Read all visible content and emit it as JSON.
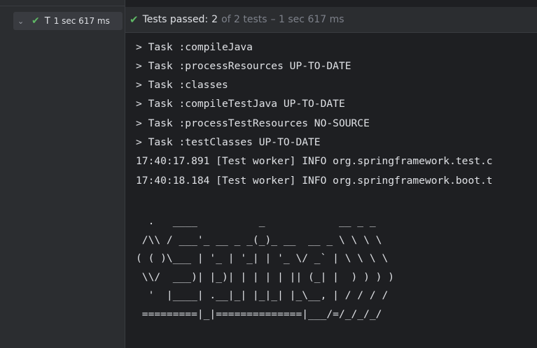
{
  "tree": {
    "chevron": "⌄",
    "check_icon": "check-icon",
    "item_name": "T",
    "item_time": "1 sec 617 ms"
  },
  "status": {
    "check_icon": "check-icon",
    "passed_label": "Tests passed:",
    "passed_count": "2",
    "of_total": "of 2 tests",
    "duration": "– 1 sec 617 ms"
  },
  "console": {
    "lines": [
      "> Task :compileJava",
      "> Task :processResources UP-TO-DATE",
      "> Task :classes",
      "> Task :compileTestJava UP-TO-DATE",
      "> Task :processTestResources NO-SOURCE",
      "> Task :testClasses UP-TO-DATE",
      "17:40:17.891 [Test worker] INFO org.springframework.test.c",
      "17:40:18.184 [Test worker] INFO org.springframework.boot.t",
      "",
      "  .   ____          _            __ _ _",
      " /\\\\ / ___'_ __ _ _(_)_ __  __ _ \\ \\ \\ \\",
      "( ( )\\___ | '_ | '_| | '_ \\/ _` | \\ \\ \\ \\",
      " \\\\/  ___)| |_)| | | | | || (_| |  ) ) ) )",
      "  '  |____| .__|_| |_|_| |_\\__, | / / / /",
      " =========|_|==============|___/=/_/_/_/"
    ]
  },
  "colors": {
    "success": "#5fb865",
    "background": "#1e1f22",
    "panel": "#2b2d30"
  }
}
